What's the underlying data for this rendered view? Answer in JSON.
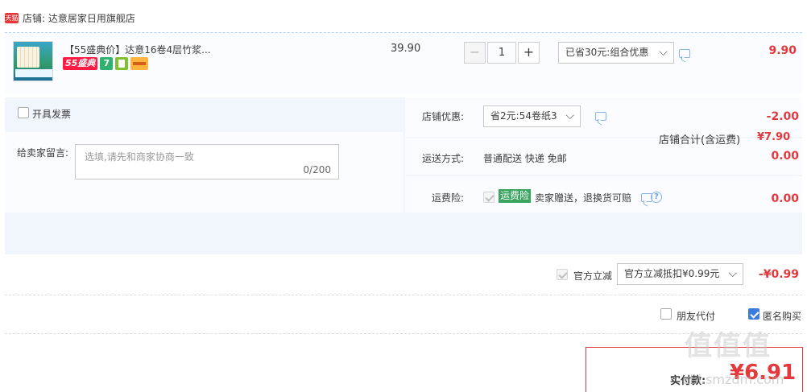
{
  "shop": {
    "badge": "天猫",
    "title": "店铺: 达意居家日用旗舰店"
  },
  "item": {
    "title": "【55盛典价】达意16卷4层竹浆...",
    "tags": [
      "55盛典",
      "7"
    ],
    "unit_price": "39.90",
    "quantity": "1",
    "qty_minus": "−",
    "qty_plus": "+",
    "combo_select": "已省30元:组合优惠",
    "subtotal": "9.90"
  },
  "settlement": {
    "invoice_label": "开具发票",
    "remark_label": "给卖家留言:",
    "remark_placeholder": "选填,请先和商家协商一致",
    "remark_count": "0/200",
    "shop_discount_label": "店铺优惠:",
    "shop_discount_select": "省2元:54卷纸3",
    "shop_discount_amount": "-2.00",
    "shipping_label": "运送方式:",
    "shipping_value": "普通配送 快递 免邮",
    "shipping_amount": "0.00",
    "insurance_label": "运费险:",
    "insurance_badge": "运费险",
    "insurance_text": "卖家赠送，退换货可赔",
    "insurance_amount": "0.00",
    "total_label": "店铺合计(含运费)",
    "total_value": "¥7.90"
  },
  "official": {
    "label": "官方立减",
    "select": "官方立减抵扣¥0.99元",
    "amount": "-¥0.99"
  },
  "options": {
    "friend_pay": "朋友代付",
    "anonymous": "匿名购买"
  },
  "payment": {
    "label": "实付款:",
    "value": "¥6.91"
  },
  "watermark": {
    "main": "值值值",
    "sub": "zhi.smzdm.com"
  },
  "colors": {
    "accent_red": "#e4393c",
    "checkbox_blue": "#3d7be0",
    "insurance_green": "#3aa55f"
  }
}
